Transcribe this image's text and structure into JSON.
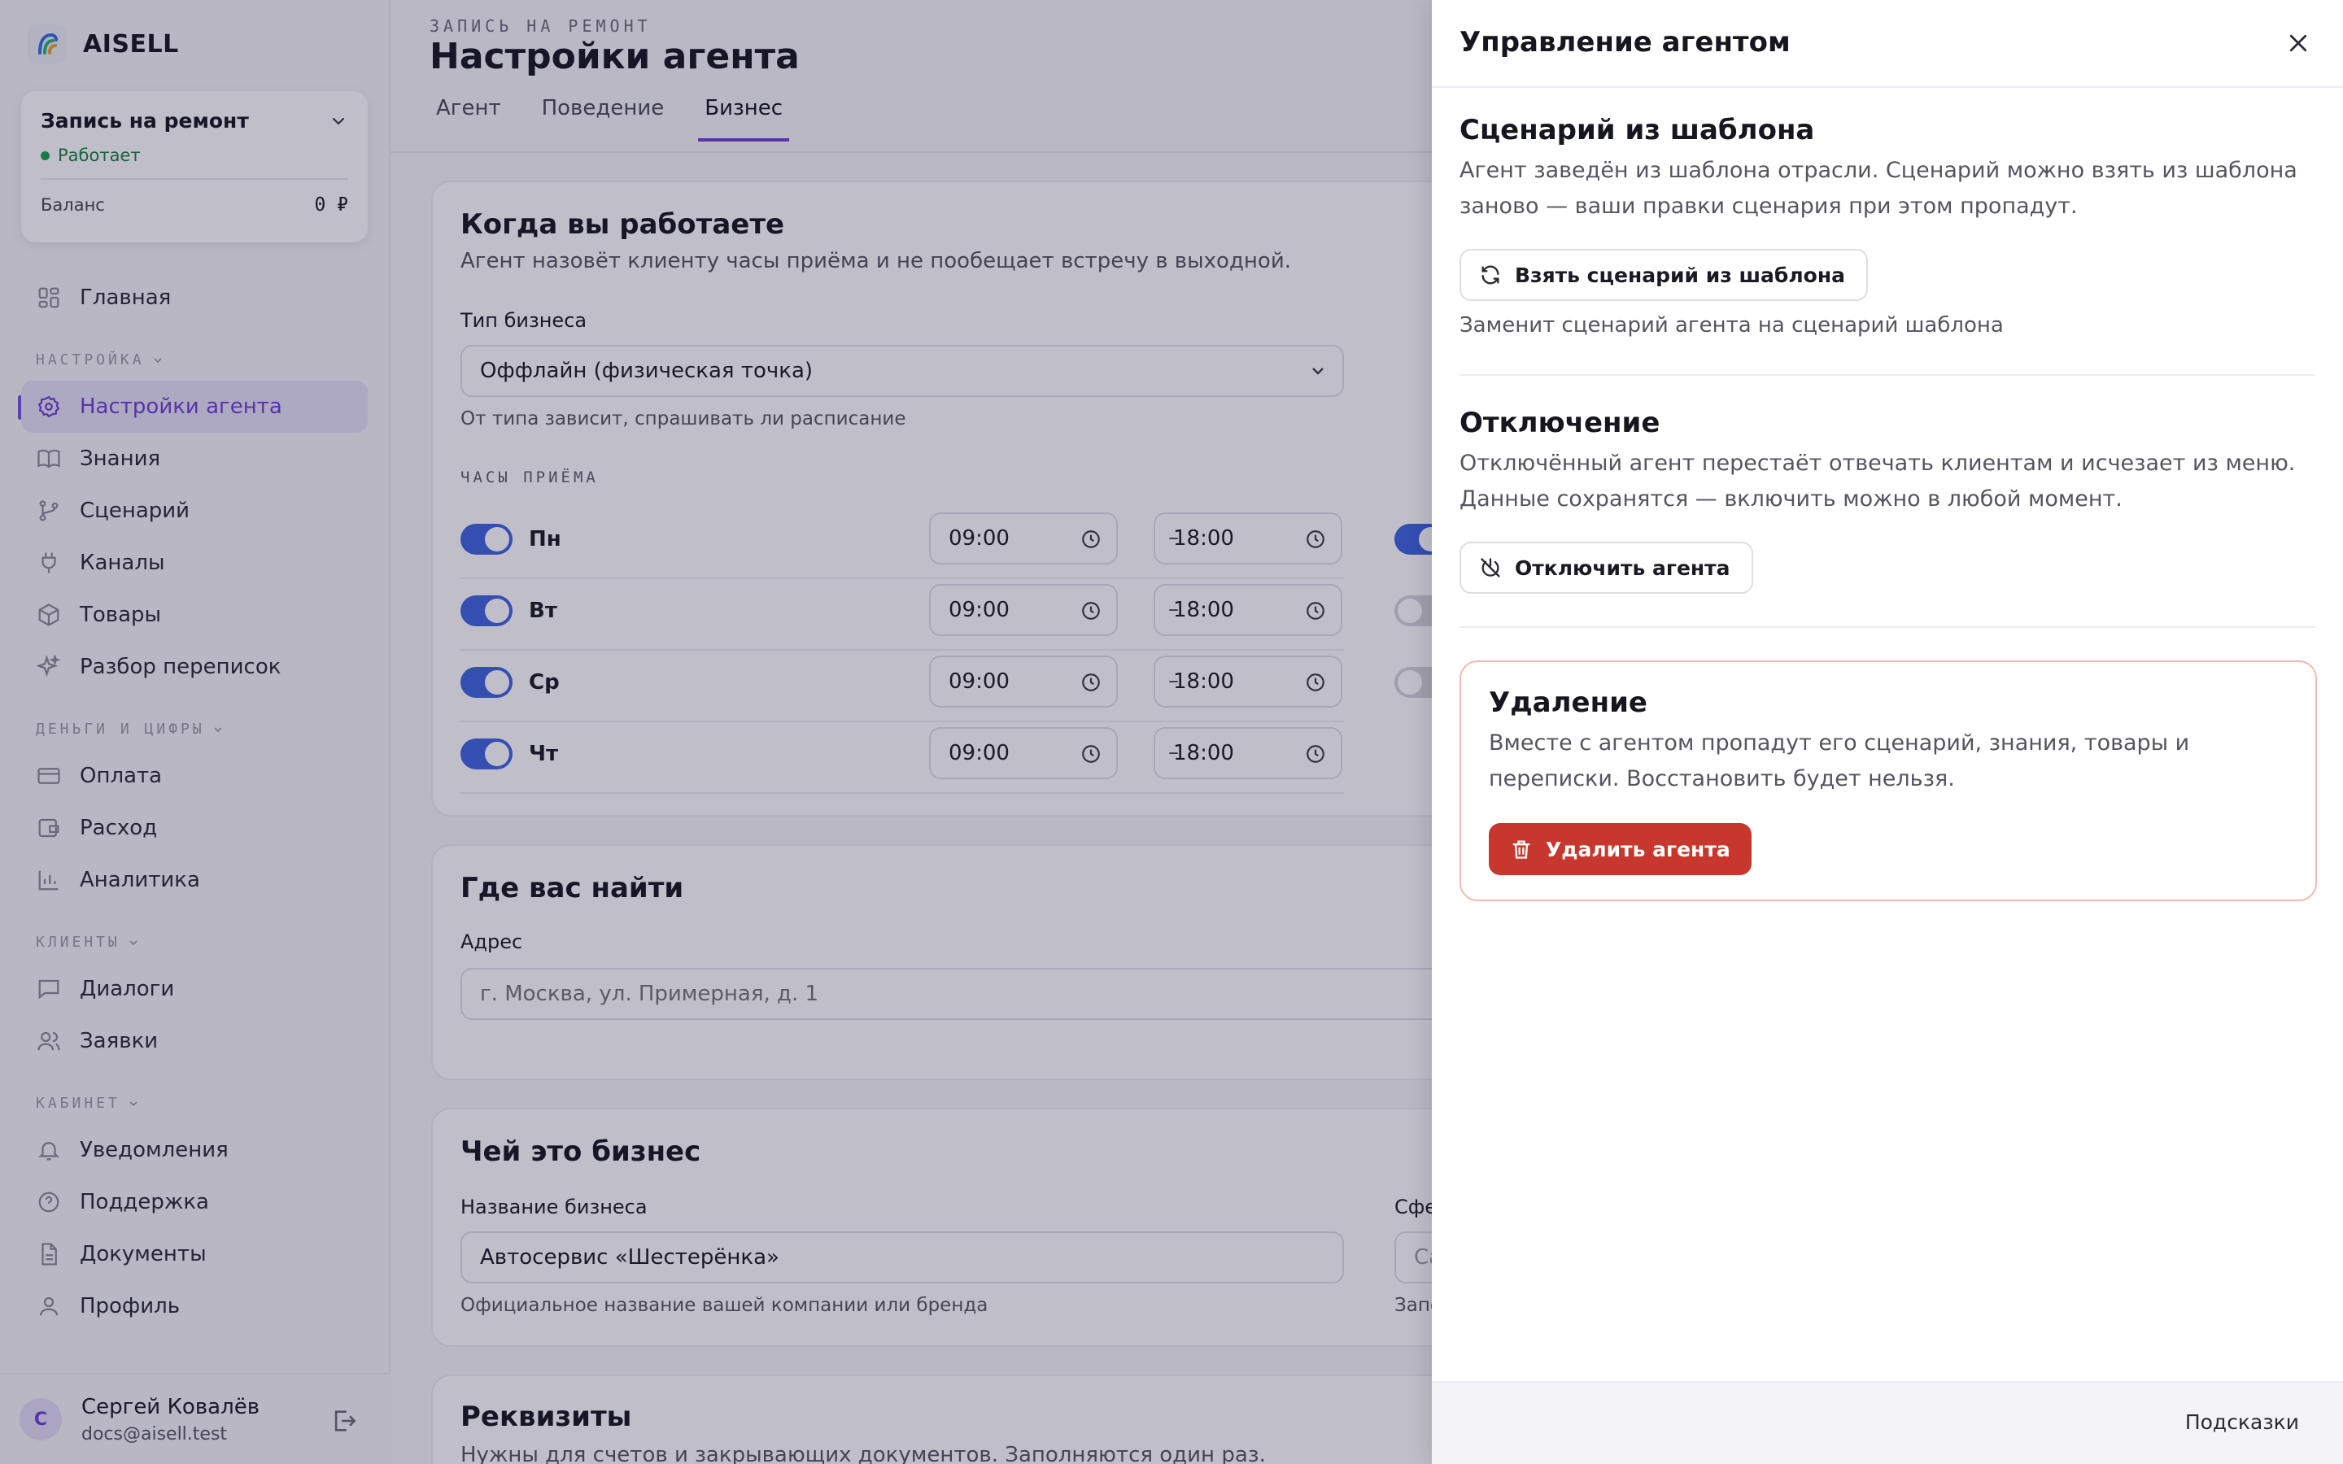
{
  "app": {
    "name": "AISELL"
  },
  "agent_card": {
    "name": "Запись на ремонт",
    "status": "Работает",
    "balance_label": "Баланс",
    "balance_value": "0 ₽"
  },
  "nav": {
    "home": "Главная",
    "section_settings": "НАСТРОЙКА",
    "agent_settings": "Настройки агента",
    "knowledge": "Знания",
    "scenario": "Сценарий",
    "channels": "Каналы",
    "products": "Товары",
    "analysis": "Разбор переписок",
    "section_money": "ДЕНЬГИ И ЦИФРЫ",
    "payment": "Оплата",
    "expense": "Расход",
    "analytics": "Аналитика",
    "section_clients": "КЛИЕНТЫ",
    "dialogs": "Диалоги",
    "requests": "Заявки",
    "section_cabinet": "КАБИНЕТ",
    "notifications": "Уведомления",
    "support": "Поддержка",
    "documents": "Документы",
    "profile": "Профиль"
  },
  "user": {
    "initial": "С",
    "name": "Сергей Ковалёв",
    "email": "docs@aisell.test"
  },
  "page": {
    "eyebrow": "ЗАПИСЬ НА РЕМОНТ",
    "title": "Настройки агента",
    "tabs": [
      "Агент",
      "Поведение",
      "Бизнес"
    ],
    "active_tab": "Бизнес"
  },
  "work_card": {
    "title": "Когда вы работаете",
    "subtitle": "Агент назовёт клиенту часы приёма и не пообещает встречу в выходной.",
    "type_label": "Тип бизнеса",
    "type_value": "Оффлайн (физическая точка)",
    "type_hint": "От типа зависит, спрашивать ли расписание",
    "hours_label": "ЧАСЫ ПРИЁМА",
    "days": [
      {
        "day": "Пн",
        "from": "09:00",
        "to": "18:00",
        "on": true
      },
      {
        "day": "Вт",
        "from": "09:00",
        "to": "18:00",
        "on": true
      },
      {
        "day": "Ср",
        "from": "09:00",
        "to": "18:00",
        "on": true
      },
      {
        "day": "Чт",
        "from": "09:00",
        "to": "18:00",
        "on": true
      }
    ],
    "dash": "–"
  },
  "location_card": {
    "title": "Где вас найти",
    "address_label": "Адрес",
    "address_placeholder": "г. Москва, ул. Примерная, д. 1"
  },
  "owner_card": {
    "title": "Чей это бизнес",
    "name_label": "Название бизнеса",
    "name_value": "Автосервис «Шестерёнка»",
    "name_hint": "Официальное название вашей компании или бренда",
    "sphere_label_partial": "Сфе",
    "sphere_placeholder_partial": "Са",
    "sphere_hint_partial": "Запо"
  },
  "requisites_card": {
    "title": "Реквизиты",
    "subtitle": "Нужны для счетов и закрывающих документов. Заполняются один раз."
  },
  "drawer": {
    "title": "Управление агентом",
    "template": {
      "heading": "Сценарий из шаблона",
      "text": "Агент заведён из шаблона отрасли. Сценарий можно взять из шаблона заново — ваши правки сценария при этом пропадут.",
      "button": "Взять сценарий из шаблона",
      "hint": "Заменит сценарий агента на сценарий шаблона"
    },
    "disable": {
      "heading": "Отключение",
      "text": "Отключённый агент перестаёт отвечать клиентам и исчезает из меню. Данные сохранятся — включить можно в любой момент.",
      "button": "Отключить агента"
    },
    "delete": {
      "heading": "Удаление",
      "text": "Вместе с агентом пропадут его сценарий, знания, товары и переписки. Восстановить будет нельзя.",
      "button": "Удалить агента"
    },
    "footer_link": "Подсказки"
  },
  "colors": {
    "accent": "#6b3fd6",
    "toggle_on": "#3d63e0",
    "danger": "#c8372d",
    "status_ok": "#18a34a"
  }
}
